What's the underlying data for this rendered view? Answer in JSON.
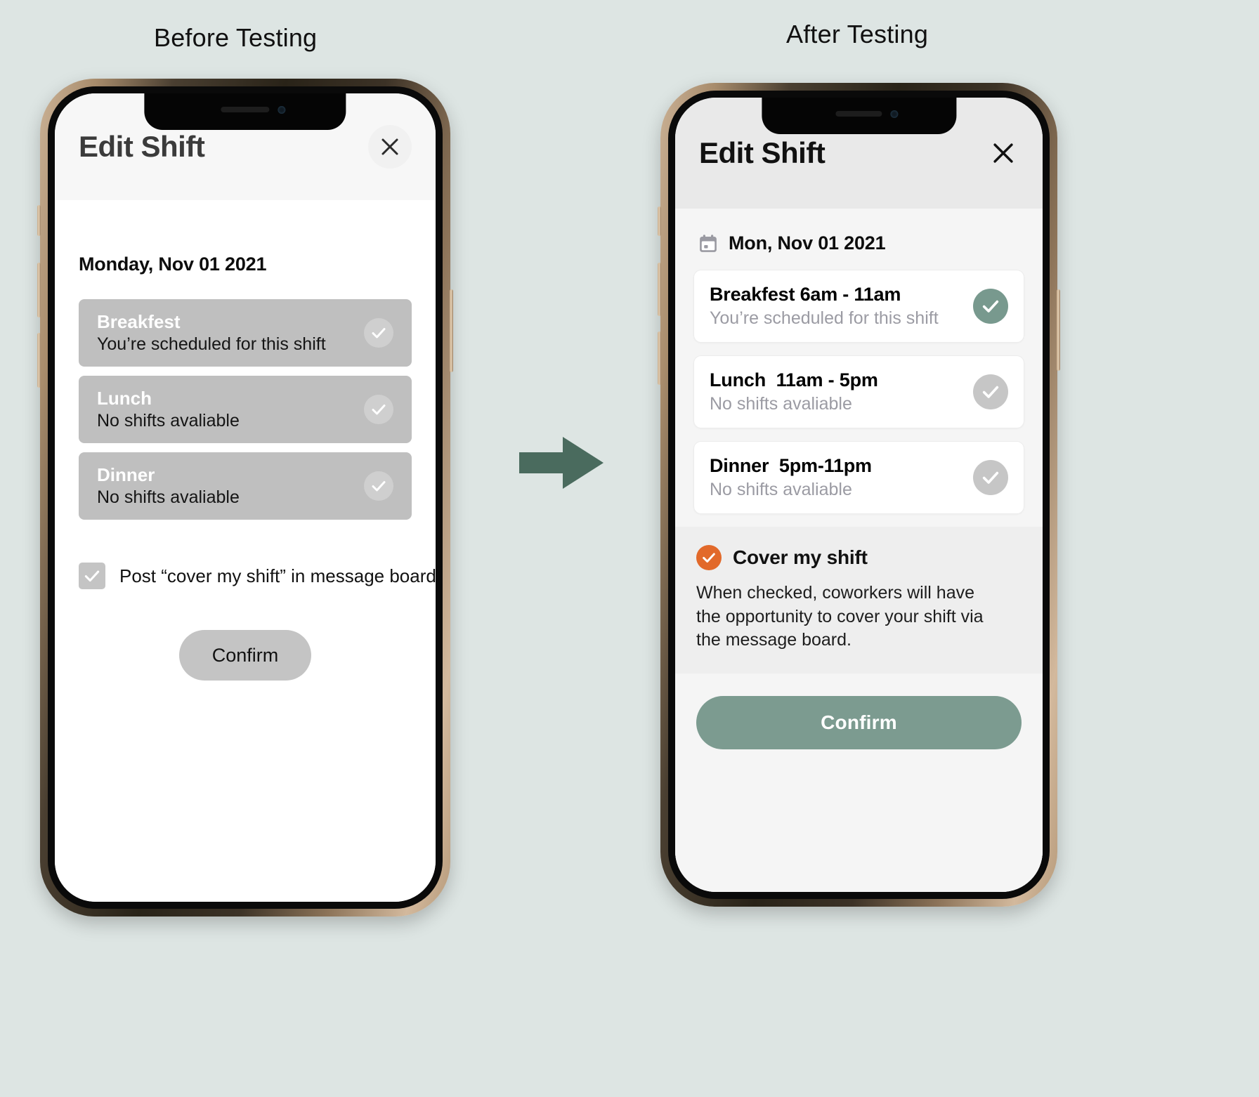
{
  "page": {
    "background_color": "#dde5e3",
    "arrow_color": "#4a6b5e",
    "arrow_name": "right-arrow-icon"
  },
  "captions": {
    "before": "Before Testing",
    "after": "After Testing"
  },
  "before": {
    "header": {
      "title": "Edit Shift",
      "close_icon": "close-icon"
    },
    "date": "Monday, Nov 01 2021",
    "shifts": [
      {
        "title": "Breakfest",
        "subtitle": "You’re scheduled for this shift",
        "checked": true
      },
      {
        "title": "Lunch",
        "subtitle": "No shifts avaliable",
        "checked": false
      },
      {
        "title": "Dinner",
        "subtitle": "No shifts avaliable",
        "checked": false
      }
    ],
    "checkbox": {
      "label": "Post “cover my shift” in message board",
      "checked": true
    },
    "confirm_label": "Confirm",
    "colors": {
      "row_background": "#bfbfbf",
      "confirm_background": "#c4c4c4",
      "header_background": "#f7f7f7"
    }
  },
  "after": {
    "header": {
      "title": "Edit Shift",
      "close_icon": "close-icon"
    },
    "date": "Mon, Nov 01 2021",
    "date_icon": "calendar-icon",
    "shifts": [
      {
        "title": "Breakfest 6am - 11am",
        "subtitle": "You’re scheduled for this shift",
        "checked": true
      },
      {
        "title": "Lunch  11am - 5pm",
        "subtitle": "No shifts avaliable",
        "checked": false
      },
      {
        "title": "Dinner  5pm-11pm",
        "subtitle": "No shifts avaliable",
        "checked": false
      }
    ],
    "cover": {
      "title": "Cover my shift",
      "icon": "check-circle-icon",
      "description": "When checked, coworkers will have the opportunity to cover your shift via the message board.",
      "checked": true
    },
    "confirm_label": "Confirm",
    "colors": {
      "accent_green": "#78998e",
      "confirm_background": "#7c9b90",
      "cover_icon_orange": "#e2692a",
      "header_background": "#e9e9e9",
      "body_background": "#f5f5f5",
      "card_background": "#ffffff",
      "disabled_check": "#c6c6c6"
    }
  }
}
